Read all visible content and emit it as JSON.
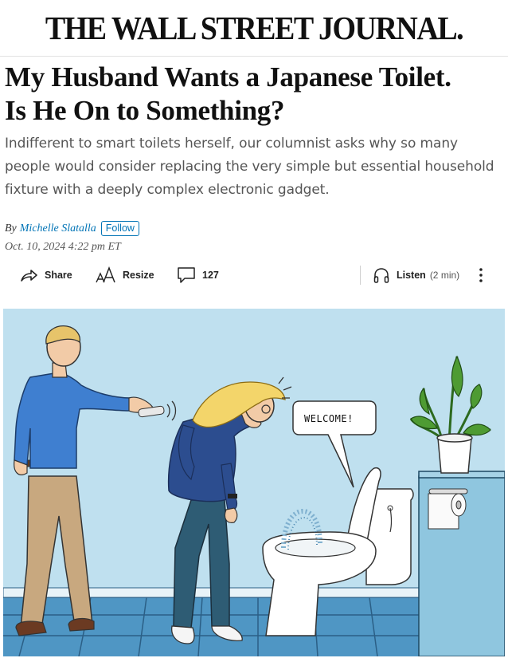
{
  "masthead": "THE WALL STREET JOURNAL.",
  "headline": {
    "line1": "My Husband Wants a Japanese Toilet.",
    "line2": "Is He On to Something?"
  },
  "dek": "Indifferent to smart toilets herself, our columnist asks why so many people would consider replacing the very simple but essential household fixture with a deeply complex electronic gadget.",
  "byline": {
    "prefix": "By",
    "author": "Michelle Slatalla",
    "follow_label": "Follow"
  },
  "date": "Oct. 10, 2024 4:22 pm ET",
  "toolbar": {
    "share": "Share",
    "resize": "Resize",
    "comments_count": "127",
    "listen": "Listen",
    "listen_duration": "(2 min)"
  },
  "illustration": {
    "speech_bubble": "WELCOME!"
  },
  "icons": {
    "share": "share-arrow-icon",
    "resize": "text-size-icon",
    "comments": "comment-bubble-icon",
    "listen": "headphones-icon",
    "more": "vertical-ellipsis-icon"
  },
  "colors": {
    "link": "#0274b6",
    "background": "#ffffff",
    "illustration_wall": "#bfe0ef"
  }
}
